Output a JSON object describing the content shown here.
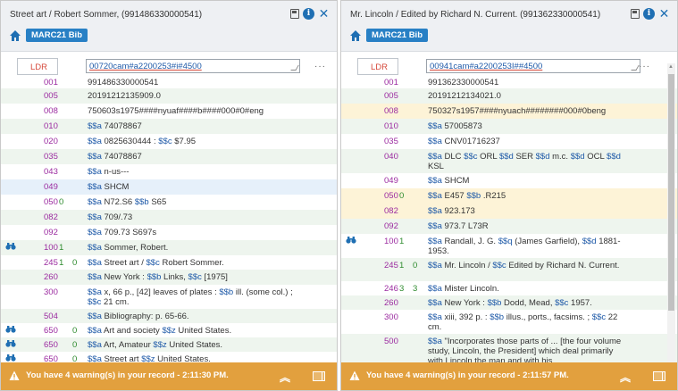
{
  "colors": {
    "header_bg": "#eef0f3",
    "tag_blue": "#2880c5",
    "field_tag": "#9b2ba0",
    "indicator": "#2e8b2e",
    "subfield": "#1f5aa8",
    "ldr_label": "#d64a3c",
    "footer_bg": "#e2a03e",
    "row_alt": "#eef5ee",
    "row_highlight_blue": "#e6f0fa",
    "row_highlight_yellow": "#fdf3d7"
  },
  "left_panel": {
    "title": "Street art / Robert Sommer, (991486330000541)",
    "badge": "MARC21 Bib",
    "ldr_label": "LDR",
    "ldr_value": "00720cam#a2200253#i#4500",
    "more": "···",
    "rows": [
      {
        "tag": "001",
        "ind1": "",
        "ind2": "",
        "value": "991486330000541",
        "bg": "#ffffff",
        "bino": false
      },
      {
        "tag": "005",
        "ind1": "",
        "ind2": "",
        "value": "20191212135909.0",
        "bg": "#eef5ee",
        "bino": false
      },
      {
        "tag": "008",
        "ind1": "",
        "ind2": "",
        "value": "750603s1975####nyuaf####b####000#0#eng",
        "bg": "#ffffff",
        "bino": false
      },
      {
        "tag": "010",
        "ind1": "",
        "ind2": "",
        "value": "$$a 74078867",
        "bg": "#eef5ee",
        "bino": false
      },
      {
        "tag": "020",
        "ind1": "",
        "ind2": "",
        "value": "$$a 0825630444 : $$c $7.95",
        "bg": "#ffffff",
        "bino": false
      },
      {
        "tag": "035",
        "ind1": "",
        "ind2": "",
        "value": "$$a 74078867",
        "bg": "#eef5ee",
        "bino": false
      },
      {
        "tag": "043",
        "ind1": "",
        "ind2": "",
        "value": "$$a n-us---",
        "bg": "#ffffff",
        "bino": false
      },
      {
        "tag": "049",
        "ind1": "",
        "ind2": "",
        "value": "$$a SHCM",
        "bg": "#e6f0fa",
        "bino": false
      },
      {
        "tag": "050",
        "ind1": "0",
        "ind2": "",
        "value": "$$a N72.S6 $$b S65",
        "bg": "#ffffff",
        "bino": false
      },
      {
        "tag": "082",
        "ind1": "",
        "ind2": "",
        "value": "$$a 709/.73",
        "bg": "#eef5ee",
        "bino": false
      },
      {
        "tag": "092",
        "ind1": "",
        "ind2": "",
        "value": "$$a 709.73 S697s",
        "bg": "#ffffff",
        "bino": false
      },
      {
        "tag": "100",
        "ind1": "1",
        "ind2": "",
        "value": "$$a Sommer, Robert.",
        "bg": "#eef5ee",
        "bino": true
      },
      {
        "tag": "245",
        "ind1": "1",
        "ind2": "0",
        "value": "$$a Street art / $$c Robert Sommer.",
        "bg": "#ffffff",
        "bino": false
      },
      {
        "tag": "260",
        "ind1": "",
        "ind2": "",
        "value": "$$a New York : $$b Links, $$c [1975]",
        "bg": "#eef5ee",
        "bino": false
      },
      {
        "tag": "300",
        "ind1": "",
        "ind2": "",
        "value": "$$a x, 66 p., [42] leaves of plates : $$b ill. (some col.) ; $$c 21 cm.",
        "bg": "#ffffff",
        "bino": false
      },
      {
        "tag": "504",
        "ind1": "",
        "ind2": "",
        "value": "$$a Bibliography: p. 65-66.",
        "bg": "#eef5ee",
        "bino": false
      },
      {
        "tag": "650",
        "ind1": "",
        "ind2": "0",
        "value": "$$a Art and society $$z United States.",
        "bg": "#ffffff",
        "bino": true
      },
      {
        "tag": "650",
        "ind1": "",
        "ind2": "0",
        "value": "$$a Art, Amateur $$z United States.",
        "bg": "#eef5ee",
        "bino": true
      },
      {
        "tag": "650",
        "ind1": "",
        "ind2": "0",
        "value": "$$a Street art $$z United States.",
        "bg": "#ffffff",
        "bino": true
      }
    ],
    "warning": "You have 4 warning(s) in your record - 2:11:30 PM."
  },
  "right_panel": {
    "title": "Mr. Lincoln / Edited by Richard N. Current. (991362330000541)",
    "badge": "MARC21 Bib",
    "ldr_label": "LDR",
    "ldr_value": "00941cam#a2200253I##4500",
    "more": "···",
    "rows": [
      {
        "tag": "001",
        "ind1": "",
        "ind2": "",
        "value": "991362330000541",
        "bg": "#ffffff",
        "bino": false
      },
      {
        "tag": "005",
        "ind1": "",
        "ind2": "",
        "value": "20191212134021.0",
        "bg": "#eef5ee",
        "bino": false
      },
      {
        "tag": "008",
        "ind1": "",
        "ind2": "",
        "value": "750327s1957####nyuach########000#0beng",
        "bg": "#fdf3d7",
        "bino": false
      },
      {
        "tag": "010",
        "ind1": "",
        "ind2": "",
        "value": "$$a 57005873",
        "bg": "#eef5ee",
        "bino": false
      },
      {
        "tag": "035",
        "ind1": "",
        "ind2": "",
        "value": "$$a CNV01716237",
        "bg": "#ffffff",
        "bino": false
      },
      {
        "tag": "040",
        "ind1": "",
        "ind2": "",
        "value": "$$a DLC $$c ORL $$d SER $$d m.c. $$d OCL $$d KSL",
        "bg": "#eef5ee",
        "bino": false
      },
      {
        "tag": "049",
        "ind1": "",
        "ind2": "",
        "value": "$$a SHCM",
        "bg": "#ffffff",
        "bino": false
      },
      {
        "tag": "050",
        "ind1": "0",
        "ind2": "",
        "value": "$$a E457 $$b .R215",
        "bg": "#fdf3d7",
        "bino": false
      },
      {
        "tag": "082",
        "ind1": "",
        "ind2": "",
        "value": "$$a 923.173",
        "bg": "#fdf3d7",
        "bino": false
      },
      {
        "tag": "092",
        "ind1": "",
        "ind2": "",
        "value": "$$a 973.7 L73R",
        "bg": "#eef5ee",
        "bino": false
      },
      {
        "tag": "100",
        "ind1": "1",
        "ind2": "",
        "value": "$$a Randall, J. G. $$q (James Garfield), $$d 1881-1953.",
        "bg": "#ffffff",
        "bino": true
      },
      {
        "tag": "245",
        "ind1": "1",
        "ind2": "0",
        "value": "$$a Mr. Lincoln / $$c Edited by Richard N. Current.",
        "bg": "#eef5ee",
        "bino": false
      },
      {
        "tag": "246",
        "ind1": "3",
        "ind2": "3",
        "value": "$$a Mister Lincoln.",
        "bg": "#ffffff",
        "bino": false
      },
      {
        "tag": "260",
        "ind1": "",
        "ind2": "",
        "value": "$$a New York : $$b Dodd, Mead, $$c 1957.",
        "bg": "#eef5ee",
        "bino": false
      },
      {
        "tag": "300",
        "ind1": "",
        "ind2": "",
        "value": "$$a xiii, 392 p. : $$b illus., ports., facsims. ; $$c 22 cm.",
        "bg": "#ffffff",
        "bino": false
      },
      {
        "tag": "500",
        "ind1": "",
        "ind2": "",
        "value": "$$a \"Incorporates those parts of ... [the four volume study, Lincoln, the President] which deal primarily with Lincoln the man and with his",
        "bg": "#eef5ee",
        "bino": false
      }
    ],
    "warning": "You have 4 warning(s) in your record - 2:11:57 PM."
  }
}
